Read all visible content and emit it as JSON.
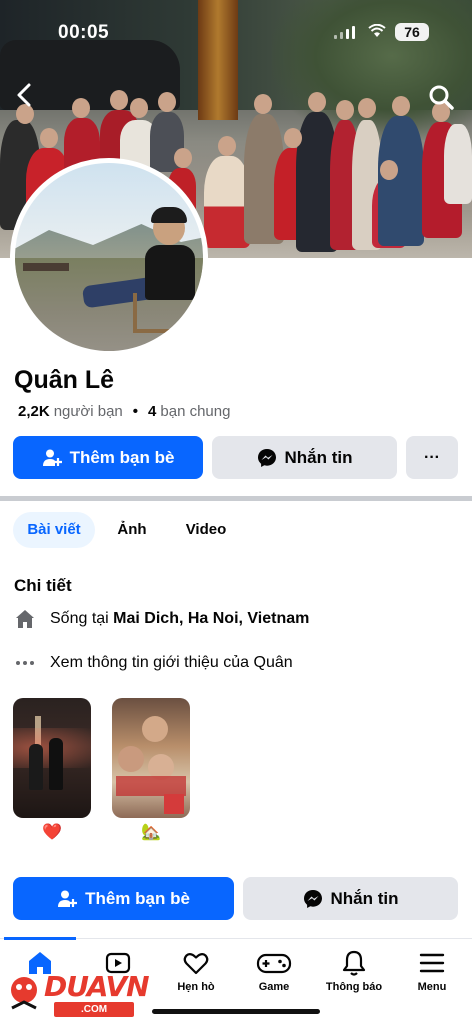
{
  "status_bar": {
    "time": "00:05",
    "battery": "76"
  },
  "profile": {
    "name": "Quân Lê",
    "friends_count": "2,2K",
    "friends_label": "người bạn",
    "mutual_count": "4",
    "mutual_label": "bạn chung"
  },
  "actions": {
    "add_friend": "Thêm bạn bè",
    "message": "Nhắn tin",
    "more": "···"
  },
  "tabs": [
    {
      "label": "Bài viết",
      "active": true
    },
    {
      "label": "Ảnh",
      "active": false
    },
    {
      "label": "Video",
      "active": false
    }
  ],
  "details": {
    "title": "Chi tiết",
    "lives_in_prefix": "Sống tại",
    "lives_in_place": "Mai Dich, Ha Noi, Vietnam",
    "see_about": "Xem thông tin giới thiệu của Quân"
  },
  "stories": [
    {
      "emoji": "❤️"
    },
    {
      "emoji": "🏡"
    }
  ],
  "bottom_actions": {
    "add_friend": "Thêm bạn bè",
    "message": "Nhắn tin"
  },
  "nav": [
    {
      "label": "",
      "icon": "home-icon"
    },
    {
      "label": "",
      "icon": "video-icon"
    },
    {
      "label": "Hẹn hò",
      "icon": "heart-icon"
    },
    {
      "label": "Game",
      "icon": "gamepad-icon"
    },
    {
      "label": "Thông báo",
      "icon": "bell-icon"
    },
    {
      "label": "Menu",
      "icon": "menu-icon"
    }
  ],
  "watermark": {
    "text": "DUAVN",
    "sub": ".COM"
  },
  "colors": {
    "primary": "#0866ff",
    "secondary": "#e4e6eb",
    "muted": "#65676b"
  }
}
